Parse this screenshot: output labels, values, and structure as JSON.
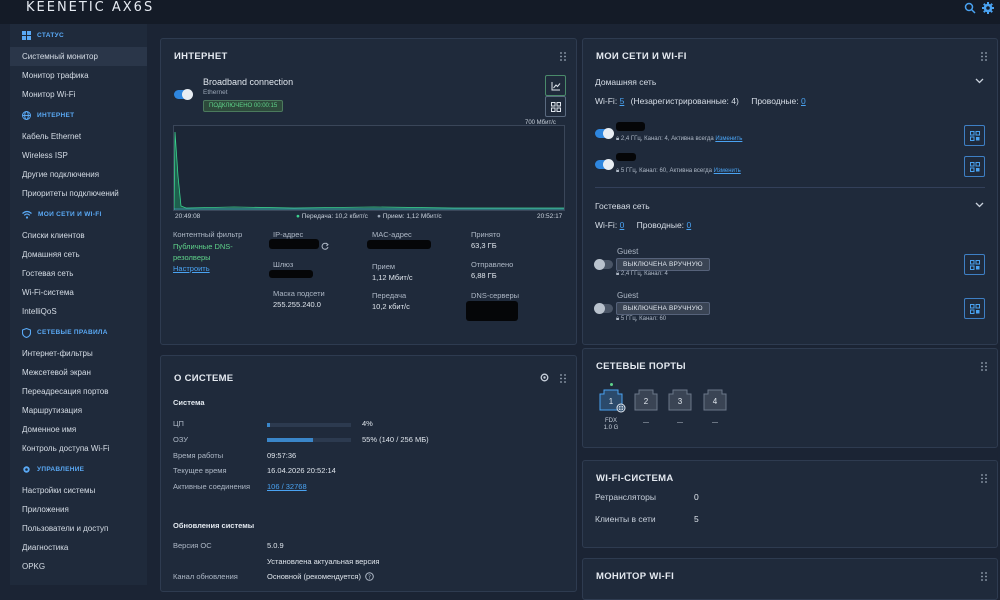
{
  "app": {
    "brand": "KEENETIC AX6S"
  },
  "sidebar": {
    "sections": [
      {
        "title": "СТАТУС",
        "items": [
          "Системный монитор",
          "Монитор трафика",
          "Монитор Wi-Fi"
        ]
      },
      {
        "title": "ИНТЕРНЕТ",
        "items": [
          "Кабель Ethernet",
          "Wireless ISP",
          "Другие подключения",
          "Приоритеты подключений"
        ]
      },
      {
        "title": "МОИ СЕТИ И WI-FI",
        "items": [
          "Списки клиентов",
          "Домашняя сеть",
          "Гостевая сеть",
          "Wi-Fi-система",
          "IntelliQoS"
        ]
      },
      {
        "title": "СЕТЕВЫЕ ПРАВИЛА",
        "items": [
          "Интернет-фильтры",
          "Межсетевой экран",
          "Переадресация портов",
          "Маршрутизация",
          "Доменное имя",
          "Контроль доступа Wi-Fi"
        ]
      },
      {
        "title": "УПРАВЛЕНИЕ",
        "items": [
          "Настройки системы",
          "Приложения",
          "Пользователи и доступ",
          "Диагностика",
          "OPKG"
        ]
      }
    ],
    "active": "Системный монитор"
  },
  "internet": {
    "title": "ИНТЕРНЕТ",
    "conn_name": "Broadband connection",
    "conn_type": "Ethernet",
    "status_badge": "ПОДКЛЮЧЕНО 00:00:15",
    "chart_max": "700 Мбит/с",
    "time_start": "20:49:08",
    "time_end": "20:52:17",
    "legend_tx": "Передача: 10,2 кбит/с",
    "legend_rx": "Прием: 1,12 Мбит/с",
    "content_filter_label": "Контентный фильтр",
    "content_filter_value": "Публичные DNS-резолверы",
    "content_filter_link": "Настроить",
    "ip_label": "IP-адрес",
    "gateway_label": "Шлюз",
    "mask_label": "Маска подсети",
    "mask_value": "255.255.240.0",
    "mac_label": "MAC-адрес",
    "rx_label": "Прием",
    "rx_value": "1,12 Мбит/с",
    "tx_label": "Передача",
    "tx_value": "10,2 кбит/с",
    "recv_label": "Принято",
    "recv_value": "63,3 ГБ",
    "sent_label": "Отправлено",
    "sent_value": "6,88 ГБ",
    "dns_label": "DNS-серверы"
  },
  "system": {
    "title": "О СИСТЕМЕ",
    "section": "Система",
    "cpu_label": "ЦП",
    "cpu_value": "4%",
    "cpu_level": 0.04,
    "ram_label": "ОЗУ",
    "ram_value": "55% (140 / 256 МБ)",
    "ram_level": 0.55,
    "uptime_label": "Время работы",
    "uptime_value": "09:57:36",
    "time_label": "Текущее время",
    "time_value": "16.04.2026 20:52:14",
    "sessions_label": "Активные соединения",
    "sessions_value": "106 / 32768",
    "updates_title": "Обновления системы",
    "os_label": "Версия ОС",
    "os_value": "5.0.9",
    "os_status": "Установлена актуальная версия",
    "channel_label": "Канал обновления",
    "channel_value": "Основной (рекомендуется)"
  },
  "wifi": {
    "title": "МОИ СЕТИ И WI-FI",
    "home_title": "Домашняя сеть",
    "home_wifi_label": "Wi-Fi:",
    "home_wifi_count": "5",
    "home_unreg": "(Незарегистрированные: 4)",
    "home_wired_label": "Проводные:",
    "home_wired_count": "0",
    "net1_info": "2,4 ГГц, Канал: 4, Активна всегда",
    "net2_info": "5 ГГц, Канал: 60, Активна всегда",
    "change_link": "Изменить",
    "guest_title": "Гостевая сеть",
    "guest_wifi_count": "0",
    "guest_wired_count": "0",
    "guest1_name": "Guest",
    "guest1_badge": "ВЫКЛЮЧЕНА ВРУЧНУЮ",
    "guest1_info": "2,4 ГГц, Канал: 4",
    "guest2_name": "Guest",
    "guest2_badge": "ВЫКЛЮЧЕНА ВРУЧНУЮ",
    "guest2_info": "5 ГГц, Канал: 60"
  },
  "ports": {
    "title": "СЕТЕВЫЕ ПОРТЫ",
    "items": [
      {
        "num": "1",
        "status": "FDX",
        "speed": "1.0 G"
      },
      {
        "num": "2",
        "status": "—"
      },
      {
        "num": "3",
        "status": "—"
      },
      {
        "num": "4",
        "status": "—"
      }
    ]
  },
  "wifi_system": {
    "title": "WI-FI-СИСТЕМА",
    "repeaters_label": "Ретрансляторы",
    "repeaters_value": "0",
    "clients_label": "Клиенты в сети",
    "clients_value": "5"
  },
  "wifi_monitor": {
    "title": "МОНИТОР WI-FI"
  },
  "colors": {
    "accent": "#2e86de",
    "link": "#4aa3f2",
    "ok": "#5fd38a",
    "bg": "#1b2434"
  },
  "chart_data": {
    "type": "area",
    "title": "",
    "x_range": [
      "20:49:08",
      "20:52:17"
    ],
    "ymax_label": "700 Мбит/с",
    "series": [
      {
        "name": "Передача",
        "current": "10,2 кбит/с"
      },
      {
        "name": "Прием",
        "current": "1,12 Мбит/с"
      }
    ]
  }
}
